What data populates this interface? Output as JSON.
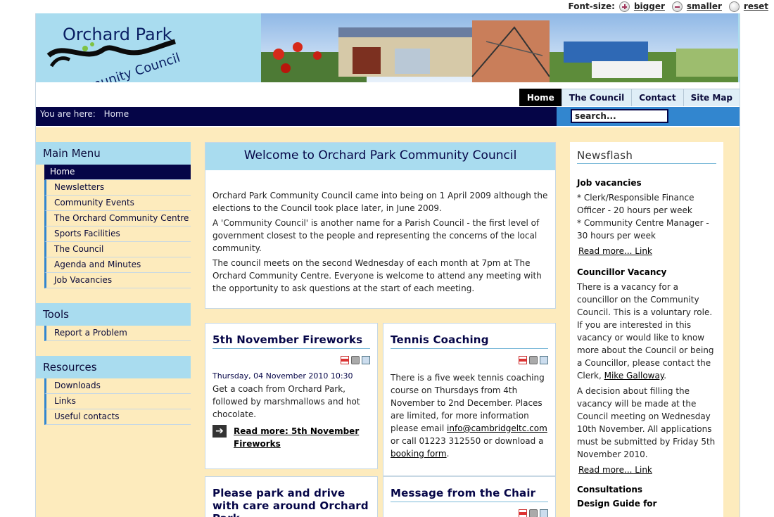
{
  "fontbar": {
    "label": "Font-size:",
    "bigger": "bigger",
    "smaller": "smaller",
    "reset": "reset"
  },
  "header": {
    "logo_line1": "Orchard Park",
    "logo_line2": "Community Council"
  },
  "topnav": [
    "Home",
    "The Council",
    "Contact",
    "Site Map"
  ],
  "breadcrumb": {
    "prefix": "You are here:",
    "current": "Home"
  },
  "search": {
    "value": "search..."
  },
  "sidebar": {
    "main_menu": {
      "title": "Main Menu",
      "items": [
        "Home",
        "Newsletters",
        "Community Events",
        "The Orchard Community Centre",
        "Sports Facilities",
        "The Council",
        "Agenda and Minutes",
        "Job Vacancies"
      ]
    },
    "tools": {
      "title": "Tools",
      "items": [
        "Report a Problem"
      ]
    },
    "resources": {
      "title": "Resources",
      "items": [
        "Downloads",
        "Links",
        "Useful contacts"
      ]
    }
  },
  "welcome": {
    "title": "Welcome to Orchard Park Community Council",
    "p1": "Orchard Park Community Council came into being on 1 April 2009 although the elections to the Council took place later, in June 2009.",
    "p2": "A 'Community Council'  is another name for a Parish Council - the first level of government closest to the people and representing the concerns of the local community.",
    "p3": "The council meets on the second Wednesday of each month at 7pm at The Orchard Community Centre. Everyone is welcome to attend any meeting with the opportunity to ask questions at the start of each meeting."
  },
  "fireworks": {
    "title": "5th November Fireworks",
    "date": "Thursday, 04 November 2010 10:30",
    "text": "Get a coach from Orchard Park, followed by marshmallows and hot chocolate.",
    "read_more": "Read more: 5th November Fireworks"
  },
  "tennis": {
    "title": "Tennis Coaching",
    "text_before": "There is a five week tennis coaching course on Thursdays from 4th November to 2nd December. Places are limited, for more information please email ",
    "email": "info@cambridgeltc.com",
    "text_middle": " or call 01223 312550 or download a ",
    "form_link": "booking form",
    "text_after": "."
  },
  "park": {
    "title": "Please park and drive with care around Orchard Park"
  },
  "chair": {
    "title": "Message from the Chair"
  },
  "newsflash": {
    "title": "Newsflash",
    "job_title": "Job vacancies",
    "job_line1": "* Clerk/Responsible Finance Officer - 20 hours per week",
    "job_line2": "* Community Centre Manager - 30 hours per week",
    "read_more": "Read more... Link",
    "vacancy_title": "Councillor Vacancy",
    "vacancy_text": "There is a vacancy for a councillor on the Community Council. This is a voluntary role. If you are interested in this vacancy or would like to know more about the Council or being a Councillor, please contact the Clerk, ",
    "clerk_name": "Mike Galloway",
    "vacancy_end": ".",
    "decision_text": "A decision about filling the vacancy will be made at the Council meeting on Wednesday 10th November. All applications must be submitted by Friday 5th November 2010.",
    "read_more2": "Read more... Link",
    "consult_title": "Consultations",
    "consult_sub": "Design Guide for"
  }
}
